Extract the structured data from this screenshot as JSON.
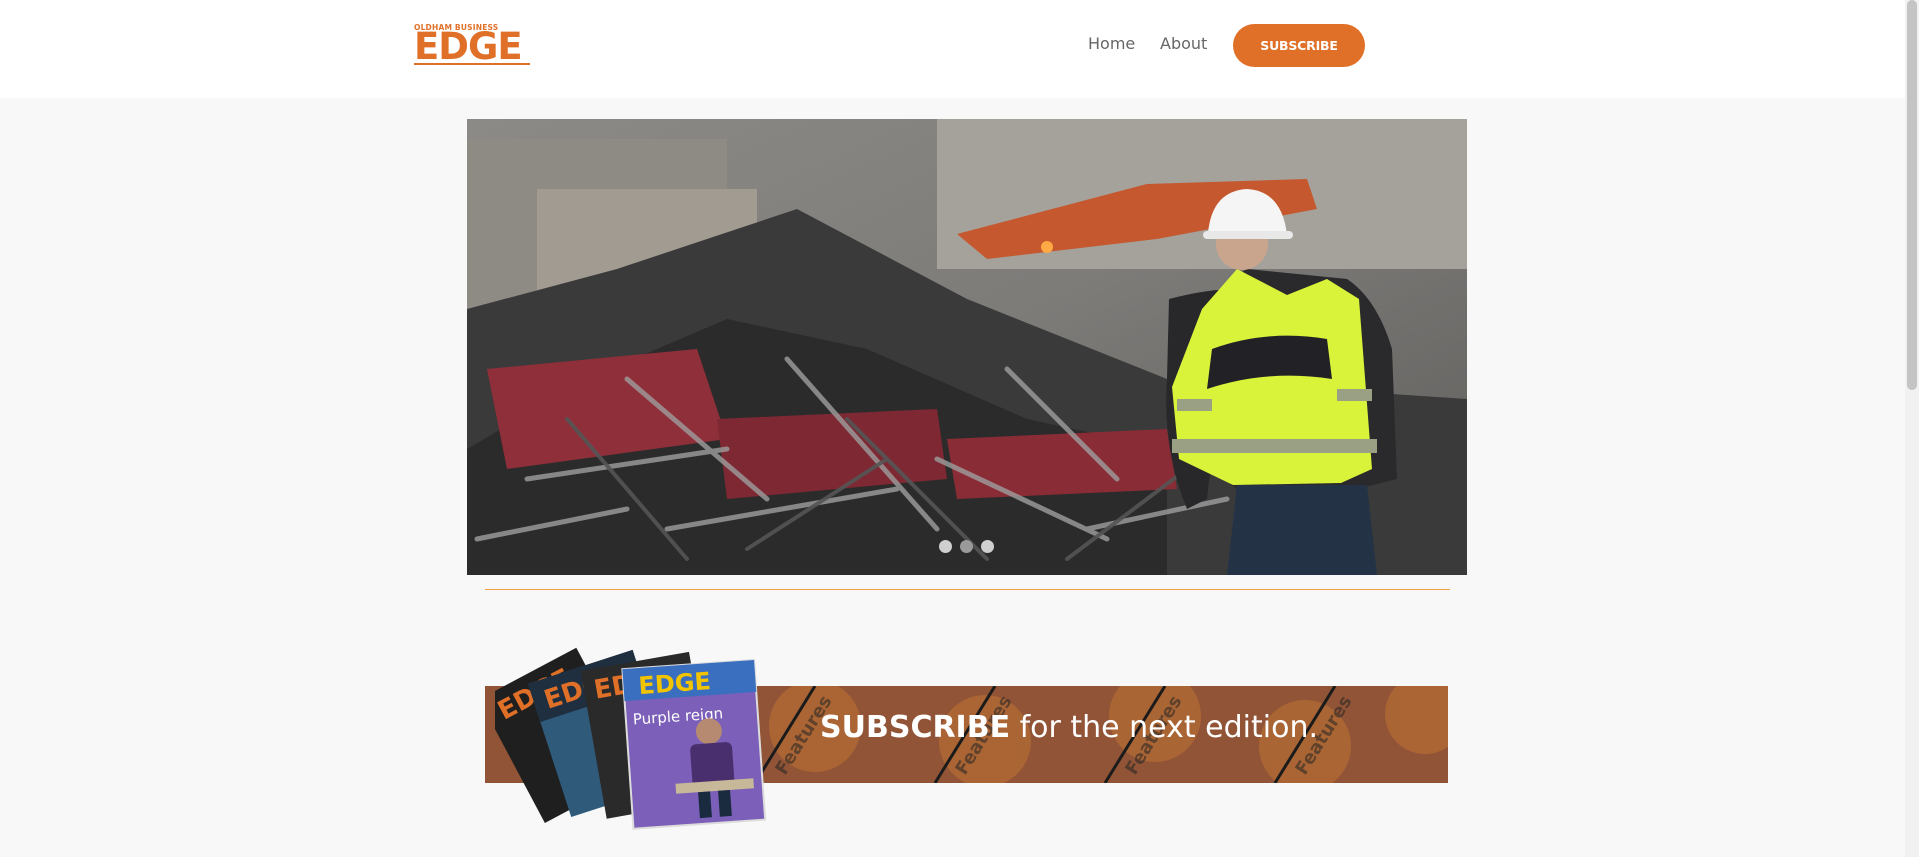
{
  "header": {
    "logo_small": "OLDHAM BUSINESS",
    "logo_main": "EDGE",
    "nav": [
      {
        "label": "Home"
      },
      {
        "label": "About"
      }
    ],
    "subscribe_label": "SUBSCRIBE"
  },
  "slider": {
    "slide_count": 3,
    "active_index": 1
  },
  "banner": {
    "strong_text": "SUBSCRIBE",
    "rest_text": " for the next edition.",
    "magazine_title": "EDGE",
    "magazine_headline": "Purple reign",
    "features_label": "Features"
  },
  "colors": {
    "brand_orange": "#e07028",
    "divider": "#f0a040",
    "banner_dark": "#8a4a2a"
  }
}
